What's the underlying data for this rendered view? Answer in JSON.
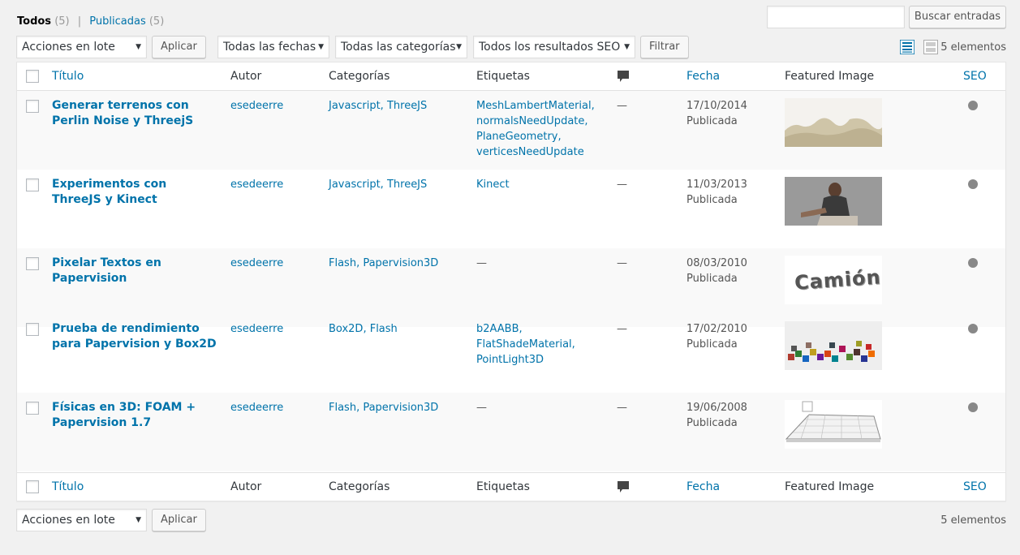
{
  "filters": {
    "all_label": "Todos",
    "all_count": "(5)",
    "separator": "|",
    "published_label": "Publicadas",
    "published_count": "(5)"
  },
  "search": {
    "value": "",
    "button_label": "Buscar entradas"
  },
  "bulk_actions": {
    "selected": "Acciones en lote",
    "apply_label": "Aplicar"
  },
  "filter_bar": {
    "dates": "Todas las fechas",
    "categories": "Todas las categorías",
    "seo": "Todos los resultados SEO",
    "filter_label": "Filtrar"
  },
  "items_count": "5 elementos",
  "columns": {
    "title": "Título",
    "author": "Autor",
    "categories": "Categorías",
    "tags": "Etiquetas",
    "date": "Fecha",
    "featured": "Featured Image",
    "seo": "SEO"
  },
  "posts": [
    {
      "title": "Generar terrenos con Perlin Noise y ThreejS",
      "author": "esedeerre",
      "categories": "Javascript, ThreeJS",
      "tags": [
        "MeshLambertMaterial,",
        "normalsNeedUpdate,",
        "PlaneGeometry,",
        "verticesNeedUpdate"
      ],
      "comments": "—",
      "date": "17/10/2014",
      "status": "Publicada",
      "thumb_label": ""
    },
    {
      "title": "Experimentos con ThreeJS y Kinect",
      "author": "esedeerre",
      "categories": "Javascript, ThreeJS",
      "tags": [
        "Kinect"
      ],
      "comments": "—",
      "date": "11/03/2013",
      "status": "Publicada",
      "thumb_label": ""
    },
    {
      "title": "Pixelar Textos en Papervision",
      "author": "esedeerre",
      "categories": "Flash, Papervision3D",
      "tags": [
        "—"
      ],
      "comments": "—",
      "date": "08/03/2010",
      "status": "Publicada",
      "thumb_label": "Camión"
    },
    {
      "title": "Prueba de rendimiento para Papervision y Box2D",
      "author": "esedeerre",
      "categories": "Box2D, Flash",
      "tags": [
        "b2AABB,",
        "FlatShadeMaterial,",
        "PointLight3D"
      ],
      "comments": "—",
      "date": "17/02/2010",
      "status": "Publicada",
      "thumb_label": ""
    },
    {
      "title": "Físicas en 3D: FOAM + Papervision 1.7",
      "author": "esedeerre",
      "categories": "Flash, Papervision3D",
      "tags": [
        "—"
      ],
      "comments": "—",
      "date": "19/06/2008",
      "status": "Publicada",
      "thumb_label": ""
    }
  ],
  "colors": {
    "link": "#0073aa",
    "seo_dot": "#888888"
  },
  "icons": {
    "comments": "comment-bubble-icon",
    "list_view": "list-view-icon",
    "excerpt_view": "excerpt-view-icon"
  }
}
